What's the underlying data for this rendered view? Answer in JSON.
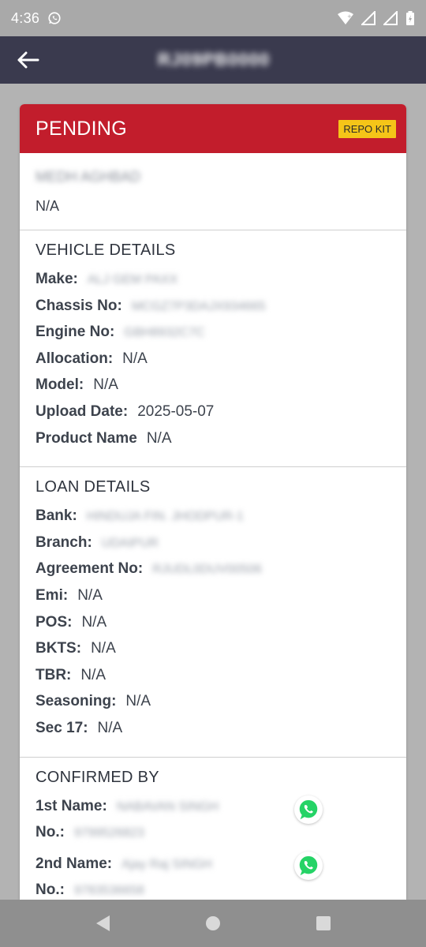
{
  "status_bar": {
    "time": "4:36"
  },
  "app_bar": {
    "title": "RJ09PB0000"
  },
  "card": {
    "status": "PENDING",
    "badge": "REPO KIT",
    "customer_name": "MEDH AGHBAD",
    "top_value": "N/A",
    "vehicle": {
      "title": "VEHICLE DETAILS",
      "rows": [
        {
          "label": "Make:",
          "value": "ALJ GEM PAXX",
          "blurred": true
        },
        {
          "label": "Chassis No:",
          "value": "MCGZ7P3DAJX934665",
          "blurred": true
        },
        {
          "label": "Engine No:",
          "value": "GBH8932C7C",
          "blurred": true
        },
        {
          "label": "Allocation:",
          "value": "N/A",
          "blurred": false
        },
        {
          "label": "Model:",
          "value": "N/A",
          "blurred": false
        },
        {
          "label": "Upload Date:",
          "value": "2025-05-07",
          "blurred": false
        },
        {
          "label": "Product Name",
          "value": "N/A",
          "blurred": false
        }
      ]
    },
    "loan": {
      "title": "LOAN DETAILS",
      "rows": [
        {
          "label": "Bank:",
          "value": "HINDUJA FIN. JHODPUR-1",
          "blurred": true
        },
        {
          "label": "Branch:",
          "value": "UDAIPUR",
          "blurred": true
        },
        {
          "label": "Agreement No:",
          "value": "RJUDL0DUV00506",
          "blurred": true
        },
        {
          "label": "Emi:",
          "value": "N/A",
          "blurred": false
        },
        {
          "label": "POS:",
          "value": "N/A",
          "blurred": false
        },
        {
          "label": "BKTS:",
          "value": "N/A",
          "blurred": false
        },
        {
          "label": "TBR:",
          "value": "N/A",
          "blurred": false
        },
        {
          "label": "Seasoning:",
          "value": "N/A",
          "blurred": false
        },
        {
          "label": "Sec 17:",
          "value": "N/A",
          "blurred": false
        }
      ]
    },
    "confirmed": {
      "title": "CONFIRMED BY",
      "first_name_label": "1st Name:",
      "first_name": "NABAVAN SINGH",
      "first_no_label": "No.:",
      "first_no": "9799526823",
      "second_name_label": "2nd Name:",
      "second_name": "Ajay Raj SINGH",
      "second_no_label": "No.:",
      "second_no": "9783536658"
    }
  },
  "colors": {
    "header_red": "#c21d2c",
    "app_bar": "#3a3a4e",
    "badge_yellow": "#f5c518",
    "whatsapp_green": "#25d366"
  }
}
